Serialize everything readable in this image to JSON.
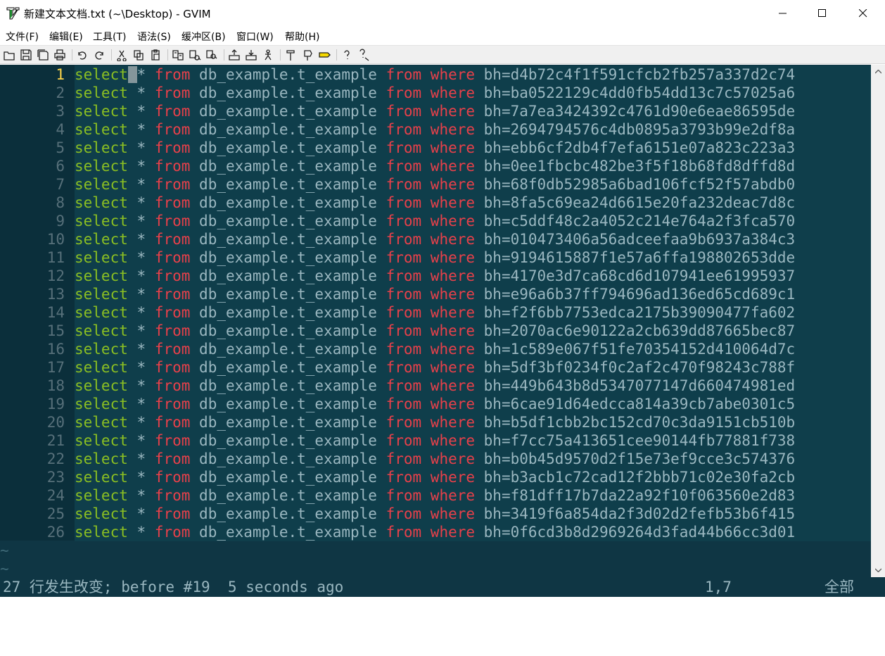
{
  "window": {
    "title": "新建文本文档.txt (~\\Desktop) - GVIM",
    "app_icon": "gvim-icon",
    "controls": [
      "minimize-icon",
      "maximize-icon",
      "close-icon"
    ]
  },
  "menu": [
    {
      "label": "文件(F)"
    },
    {
      "label": "编辑(E)"
    },
    {
      "label": "工具(T)"
    },
    {
      "label": "语法(S)"
    },
    {
      "label": "缓冲区(B)"
    },
    {
      "label": "窗口(W)"
    },
    {
      "label": "帮助(H)"
    }
  ],
  "toolbar": [
    {
      "name": "open-icon"
    },
    {
      "name": "save-icon"
    },
    {
      "name": "save-all-icon"
    },
    {
      "name": "print-icon"
    },
    {
      "sep": true
    },
    {
      "name": "undo-icon"
    },
    {
      "name": "redo-icon"
    },
    {
      "sep": true
    },
    {
      "name": "cut-icon"
    },
    {
      "name": "copy-icon"
    },
    {
      "name": "paste-icon"
    },
    {
      "sep": true
    },
    {
      "name": "replace-icon"
    },
    {
      "name": "find-next-icon"
    },
    {
      "name": "find-prev-icon"
    },
    {
      "sep": true
    },
    {
      "name": "load-session-icon"
    },
    {
      "name": "save-session-icon"
    },
    {
      "name": "run-script-icon"
    },
    {
      "sep": true
    },
    {
      "name": "make-icon"
    },
    {
      "name": "build-tags-icon"
    },
    {
      "name": "jump-tag-icon"
    },
    {
      "sep": true
    },
    {
      "name": "help-icon"
    },
    {
      "name": "find-help-icon"
    }
  ],
  "editor": {
    "current_line": 1,
    "tokens": {
      "select": "select",
      "star": "*",
      "from": "from",
      "table": "db_example.t_example",
      "where": "where",
      "prefix": "bh="
    },
    "lines": [
      {
        "n": "1",
        "hash": "d4b72c4f1f591cfcb2fb257a337d2c74"
      },
      {
        "n": "2",
        "hash": "ba0522129c4dd0fb54dd13c7c57025a6"
      },
      {
        "n": "3",
        "hash": "7a7ea3424392c4761d90e6eae86595de"
      },
      {
        "n": "4",
        "hash": "2694794576c4db0895a3793b99e2df8a"
      },
      {
        "n": "5",
        "hash": "ebb6cf2db4f7efa6151e07a823c223a3"
      },
      {
        "n": "6",
        "hash": "0ee1fbcbc482be3f5f18b68fd8dffd8d"
      },
      {
        "n": "7",
        "hash": "68f0db52985a6bad106fcf52f57abdb0"
      },
      {
        "n": "8",
        "hash": "8fa5c69ea24d6615e20fa232deac7d8c"
      },
      {
        "n": "9",
        "hash": "c5ddf48c2a4052c214e764a2f3fca570"
      },
      {
        "n": "10",
        "hash": "010473406a56adceefaa9b6937a384c3"
      },
      {
        "n": "11",
        "hash": "9194615887f1e57a6ffa198802653dde"
      },
      {
        "n": "12",
        "hash": "4170e3d7ca68cd6d107941ee61995937"
      },
      {
        "n": "13",
        "hash": "e96a6b37ff794696ad136ed65cd689c1"
      },
      {
        "n": "14",
        "hash": "f2f6bb7753edca2175b39090477fa602"
      },
      {
        "n": "15",
        "hash": "2070ac6e90122a2cb639dd87665bec87"
      },
      {
        "n": "16",
        "hash": "1c589e067f51fe70354152d410064d7c"
      },
      {
        "n": "17",
        "hash": "5df3bf0234f0c2af2c470f98243c788f"
      },
      {
        "n": "18",
        "hash": "449b643b8d5347077147d660474981ed"
      },
      {
        "n": "19",
        "hash": "6cae91d64edcca814a39cb7abe0301c5"
      },
      {
        "n": "20",
        "hash": "b5df1cbb2bc152cd70c3da9151cb510b"
      },
      {
        "n": "21",
        "hash": "f7cc75a413651cee90144fb77881f738"
      },
      {
        "n": "22",
        "hash": "b0b45d9570d2f15e73ef9cce3c574376"
      },
      {
        "n": "23",
        "hash": "b3acb1c72cad12f2bbb71c02e30fa2cb"
      },
      {
        "n": "24",
        "hash": "f81dff17b7da22a92f10f063560e2d83"
      },
      {
        "n": "25",
        "hash": "3419f6a854da2f3d02d2fefb53b6f415"
      },
      {
        "n": "26",
        "hash": "0f6cd3b8d2969264d3fad44b66cc3d01"
      }
    ],
    "empty_marker": "~"
  },
  "status": {
    "message": "27 行发生改变; before #19  5 seconds ago",
    "position": "1,7",
    "scroll": "全部"
  },
  "colors": {
    "background": "#0f3644",
    "keyword_select": "#8bbf22",
    "keyword_from_where": "#e8404a",
    "text": "#9ab7c0",
    "current_line_number": "#ffd54a"
  }
}
